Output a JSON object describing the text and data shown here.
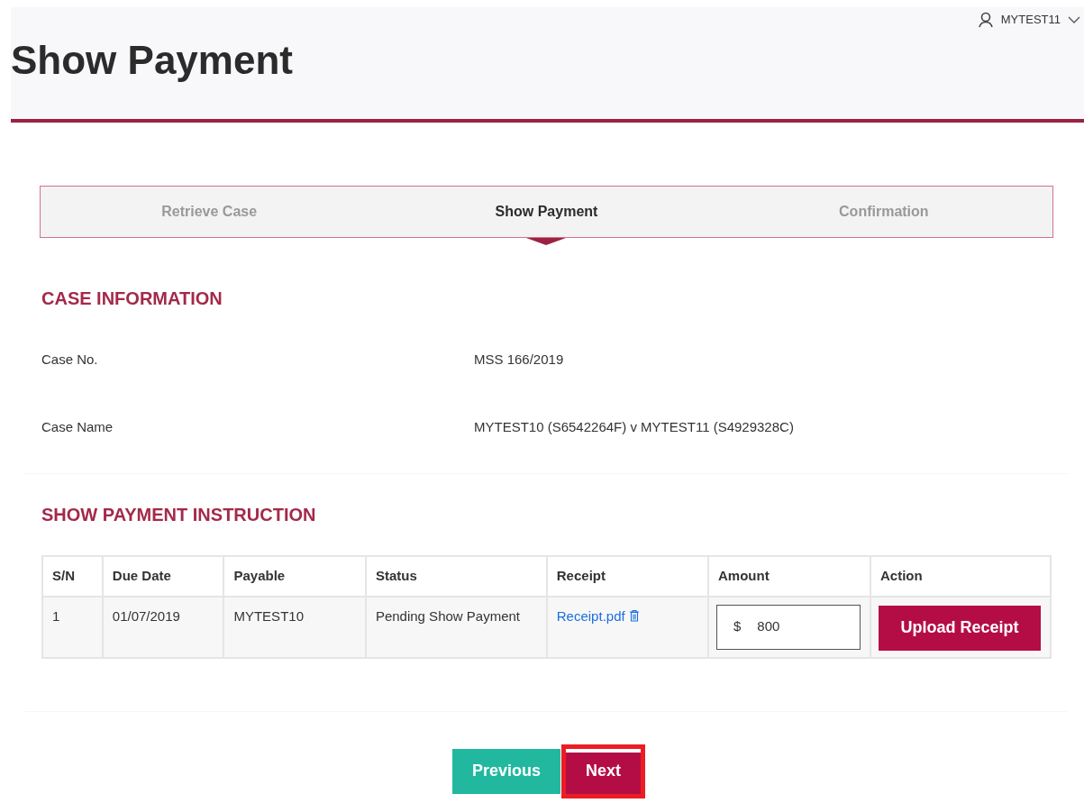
{
  "header": {
    "title": "Show Payment",
    "user": "MYTEST11"
  },
  "steps": [
    {
      "label": "Retrieve Case",
      "selected": false
    },
    {
      "label": "Show Payment",
      "selected": true
    },
    {
      "label": "Confirmation",
      "selected": false
    }
  ],
  "case_information": {
    "heading": "CASE INFORMATION",
    "fields": [
      {
        "label": "Case No.",
        "value": "MSS 166/2019"
      },
      {
        "label": "Case Name",
        "value": "MYTEST10 (S6542264F) v MYTEST11 (S4929328C)"
      }
    ]
  },
  "payment_instruction": {
    "heading": "SHOW PAYMENT INSTRUCTION",
    "columns": [
      "S/N",
      "Due Date",
      "Payable",
      "Status",
      "Receipt",
      "Amount",
      "Action"
    ],
    "rows": [
      {
        "sn": "1",
        "due_date": "01/07/2019",
        "payable": "MYTEST10",
        "status": "Pending Show Payment",
        "receipt": "Receipt.pdf",
        "currency": "$",
        "amount": "800",
        "action": "Upload Receipt"
      }
    ]
  },
  "buttons": [
    {
      "label": "Previous",
      "kind": "secondary",
      "highlighted": false
    },
    {
      "label": "Next",
      "kind": "primary",
      "highlighted": true
    }
  ]
}
